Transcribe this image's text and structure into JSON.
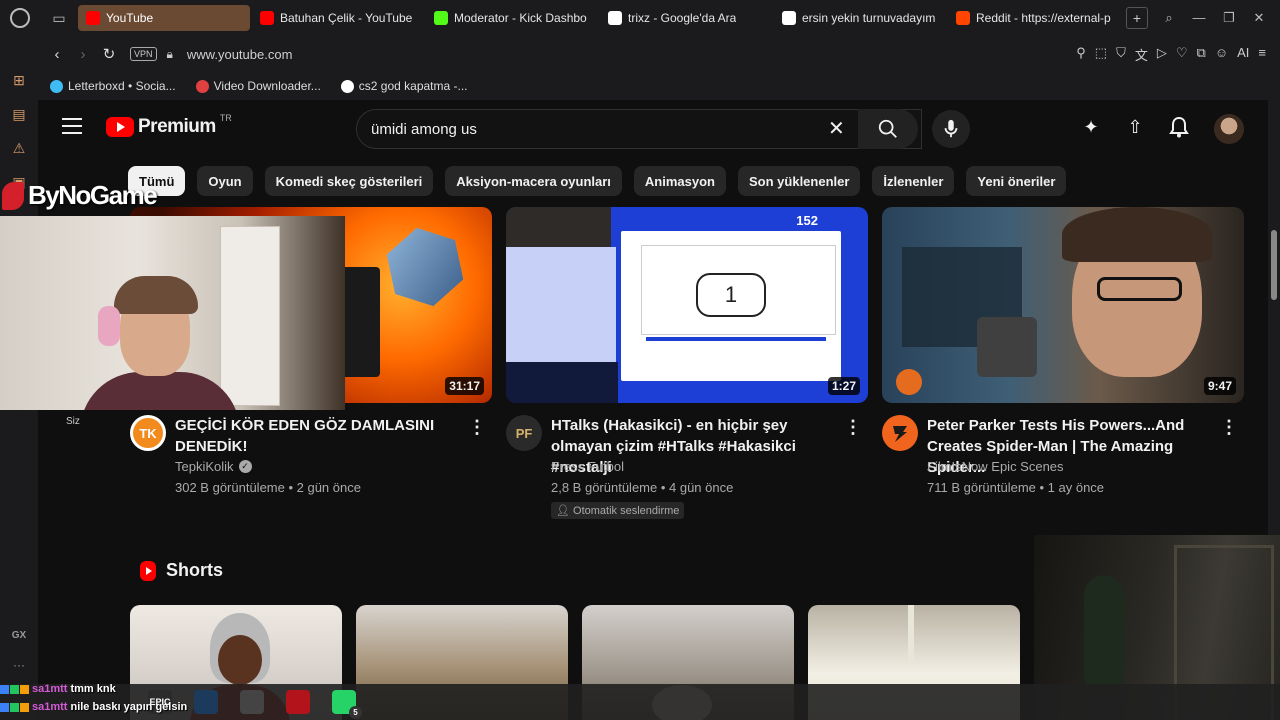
{
  "browser": {
    "tabs": [
      {
        "label": "YouTube",
        "active": true,
        "favicon": "youtube-icon",
        "color": "#ff0000"
      },
      {
        "label": "Batuhan Çelik - YouTube",
        "active": false,
        "favicon": "youtube-icon",
        "color": "#ff0000"
      },
      {
        "label": "Moderator - Kick Dashbo",
        "active": false,
        "favicon": "kick-icon",
        "color": "#53fc18"
      },
      {
        "label": "trixz - Google'da Ara",
        "active": false,
        "favicon": "google-icon",
        "color": "#ffffff"
      },
      {
        "label": "ersin yekin turnuvadayım",
        "active": false,
        "favicon": "google-icon",
        "color": "#ffffff"
      },
      {
        "label": "Reddit - https://external-p",
        "active": false,
        "favicon": "reddit-icon",
        "color": "#ff4500"
      }
    ],
    "vpn_label": "VPN",
    "url": "www.youtube.com",
    "bookmarks": [
      {
        "label": "Letterboxd • Socia...",
        "favicon": "letterboxd-icon",
        "color": "#40bcf4"
      },
      {
        "label": "Video Downloader...",
        "favicon": "downloader-icon",
        "color": "#e04040"
      },
      {
        "label": "cs2 god kapatma -...",
        "favicon": "google-icon",
        "color": "#ffffff"
      }
    ],
    "sidebar_gx": "GX",
    "sidebar_more": "···",
    "accent": "#d59b6a"
  },
  "youtube": {
    "logo_text": "Premium",
    "logo_country": "TR",
    "search_value": "ümidi among us",
    "chips": [
      "Tümü",
      "Oyun",
      "Komedi skeç gösterileri",
      "Aksiyon-macera oyunları",
      "Animasyon",
      "Son yüklenenler",
      "İzlenenler",
      "Yeni öneriler"
    ],
    "videos": [
      {
        "title": "GEÇİCİ KÖR EDEN GÖZ DAMLASINI DENEDİK!",
        "channel": "TepkiKolik",
        "verified": true,
        "stats": "302 B görüntüleme • 2 gün önce",
        "duration": "31:17",
        "avatar_text": "TK"
      },
      {
        "title": "HTalks (Hakasikci) - en hiçbir şey olmayan çizim #HTalks #Hakasikci #nostalji",
        "channel": "Press Futbol",
        "verified": false,
        "stats": "2,8 B görüntüleme • 4 gün önce",
        "duration": "1:27",
        "avatar_text": "PF",
        "badge": "Otomatik seslendirme",
        "thumb_counter": "152",
        "thumb_digit": "1"
      },
      {
        "title": "Peter Parker Tests His Powers...And Creates Spider-Man | The Amazing Spider...",
        "channel": "FilmIsNow Epic Scenes",
        "verified": false,
        "stats": "711 B görüntüleme • 1 ay önce",
        "duration": "9:47",
        "avatar_text": ""
      }
    ],
    "shorts_title": "Shorts"
  },
  "overlay": {
    "brand": "ByNoGame",
    "webcam_label": "Siz",
    "chat": [
      {
        "user": "sa1mtt",
        "message": "tmm knk"
      },
      {
        "user": "sa1mtt",
        "message": "nile baskı yapın gelsin"
      }
    ],
    "taskbar": [
      {
        "name": "epic-games-icon",
        "label": "EPIC"
      },
      {
        "name": "steam-icon",
        "label": ""
      },
      {
        "name": "speedtest-icon",
        "label": ""
      },
      {
        "name": "opera-gx-icon",
        "label": ""
      },
      {
        "name": "whatsapp-icon",
        "label": "",
        "count": "5"
      }
    ]
  }
}
